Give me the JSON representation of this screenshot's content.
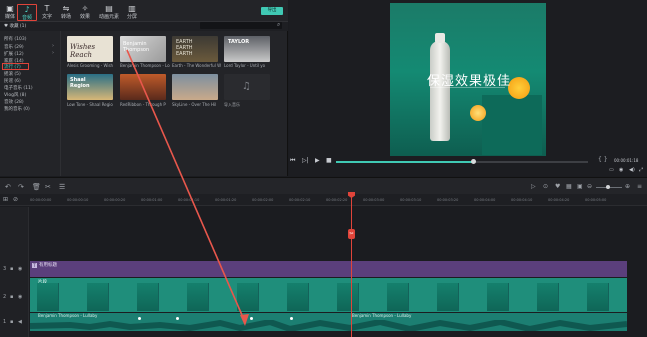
{
  "toolbar": {
    "items": [
      {
        "label": "媒体",
        "icon": "folder-icon"
      },
      {
        "label": "音频",
        "icon": "music-note-icon",
        "active": true
      },
      {
        "label": "文字",
        "icon": "text-icon"
      },
      {
        "label": "转场",
        "icon": "transition-icon"
      },
      {
        "label": "效果",
        "icon": "effects-icon"
      },
      {
        "label": "动画元素",
        "icon": "elements-icon"
      },
      {
        "label": "分屏",
        "icon": "split-screen-icon"
      }
    ],
    "export_label": "导出"
  },
  "library": {
    "header": "♥ 收藏 (1)",
    "categories": [
      {
        "label": "所有 (103)",
        "arrow": ""
      },
      {
        "label": "音乐 (29)",
        "arrow": "›"
      },
      {
        "label": "扩展 (12)",
        "arrow": "›"
      },
      {
        "label": "家庭 (14)",
        "arrow": ""
      },
      {
        "label": "流行 (7)",
        "arrow": "",
        "selected": true
      },
      {
        "label": "摇滚 (5)",
        "arrow": ""
      },
      {
        "label": "民谣 (6)",
        "arrow": ""
      },
      {
        "label": "电子音乐 (11)",
        "arrow": ""
      },
      {
        "label": "Vlog风 (8)",
        "arrow": ""
      },
      {
        "label": "音效 (28)",
        "arrow": ""
      },
      {
        "label": "我的音乐 (0)",
        "arrow": ""
      }
    ],
    "thumbnails": [
      {
        "title": "Wishes Reach",
        "caption": "Alesis Grooming - Wish"
      },
      {
        "title": "Benjamin Thompson",
        "caption": "Benjamin Thompson - Lo"
      },
      {
        "title": "EARTH EARTH EARTH",
        "caption": "Earth - The Wonderful W"
      },
      {
        "title": "TAYLOR",
        "caption": "Lord Taylor - Until yo"
      },
      {
        "title": "Shaal Region",
        "caption": "Low Tone - Shaal Regio"
      },
      {
        "title": "",
        "caption": "RedRibbon - Through P"
      },
      {
        "title": "",
        "caption": "SkyLine - Over The Hil"
      },
      {
        "title": "",
        "caption": "导入音乐"
      }
    ]
  },
  "preview": {
    "overlay_text": "保湿效果极佳",
    "timecode": "00:00:01:18"
  },
  "timeline": {
    "ruler": [
      "00:00:00:00",
      "00:00:00:10",
      "00:00:00:20",
      "00:00:01:00",
      "00:00:01:10",
      "00:00:01:20",
      "00:00:02:00",
      "00:00:02:10",
      "00:00:02:20",
      "00:00:03:00",
      "00:00:03:10",
      "00:00:03:20",
      "00:00:04:00",
      "00:00:04:10",
      "00:00:04:20",
      "00:00:05:00"
    ],
    "title_clip": "有用标题",
    "video_clip": "片段",
    "audio_clip": "Benjamin Thompson - Lullaby",
    "audio_clip_right": "Benjamin Thompson - Lullaby",
    "track_labels": [
      "3",
      "2",
      "1",
      "1"
    ]
  },
  "colors": {
    "accent": "#40c9b4",
    "playhead": "#e0443a",
    "title_track": "#5b3f7c",
    "video_track": "#1f8e7b",
    "audio_track": "#1c7f72"
  }
}
